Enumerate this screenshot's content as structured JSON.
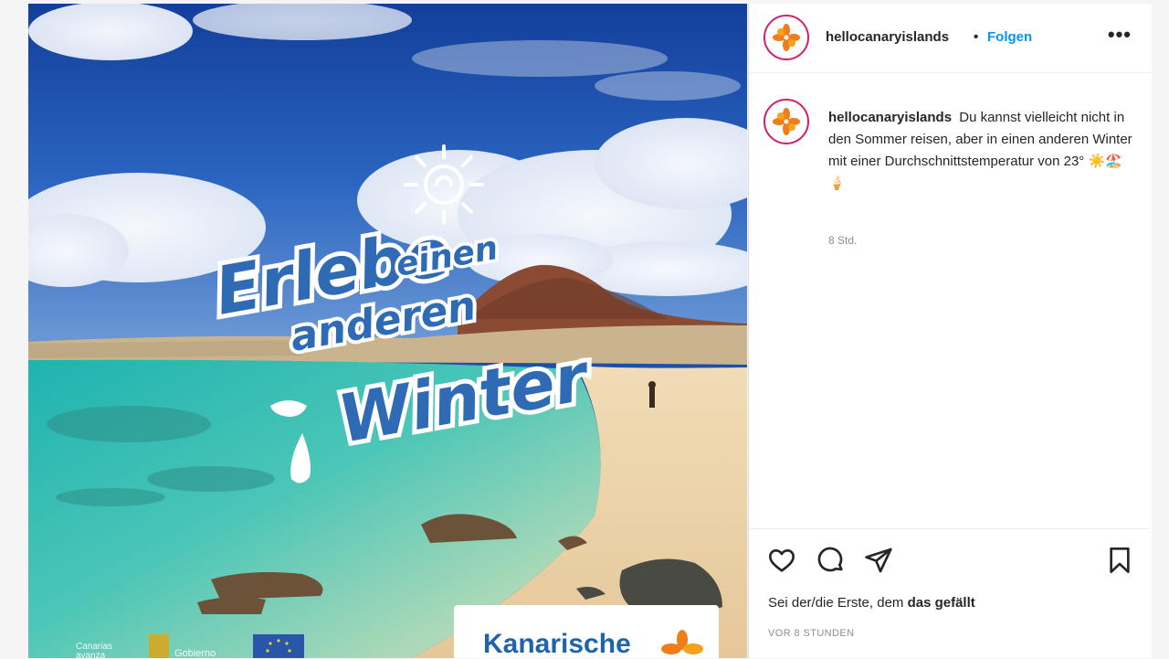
{
  "post": {
    "username": "hellocanaryislands",
    "separator": "•",
    "follow_label": "Folgen",
    "more_label": "•••",
    "caption_text": "Du kannst vielleicht nicht in den Sommer reisen, aber in einen anderen Winter mit einer Durchschnittstemperatur von 23°",
    "caption_emojis": "☀️🏖️🍦",
    "caption_time": "8 Std.",
    "likes_prefix": "Sei der/die Erste, dem",
    "likes_bold": "das gefällt",
    "post_time": "VOR 8 STUNDEN"
  },
  "image": {
    "headline_line1": "Erlebe",
    "headline_line1b": "einen",
    "headline_line2": "anderen",
    "headline_line3": "Winter",
    "brand_label": "Kanarische",
    "footer_logo1_a": "Canarias",
    "footer_logo1_b": "avanza",
    "footer_logo2": "Gobierno"
  },
  "icons": {
    "like": "heart-icon",
    "comment": "comment-icon",
    "share": "paper-plane-icon",
    "save": "bookmark-icon",
    "avatar": "flower-logo-icon"
  },
  "colors": {
    "follow": "#0095f6",
    "avatar_ring": "#d21f6c",
    "logo_orange": "#f07d1a",
    "brand_blue": "#1f63b0"
  }
}
